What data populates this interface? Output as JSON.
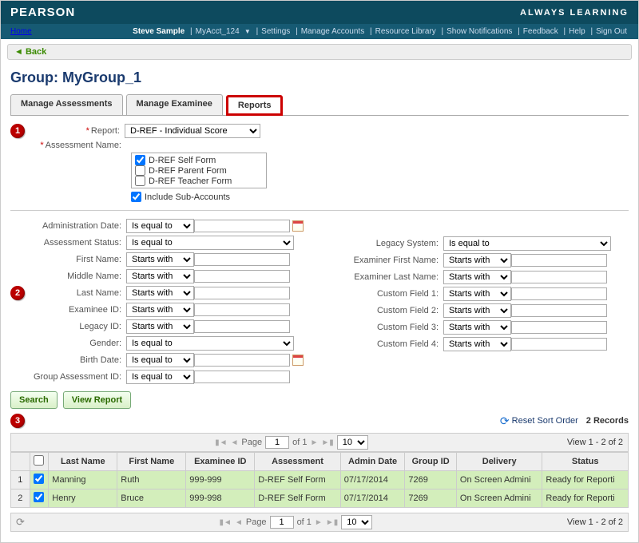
{
  "header": {
    "brand": "PEARSON",
    "tagline": "ALWAYS LEARNING"
  },
  "nav": {
    "home": "Home",
    "user": "Steve Sample",
    "links": [
      "MyAcct_124",
      "Settings",
      "Manage Accounts",
      "Resource Library",
      "Show Notifications",
      "Feedback",
      "Help",
      "Sign Out"
    ]
  },
  "back": "Back",
  "page_title": "Group: MyGroup_1",
  "tabs": {
    "manage_assessments": "Manage Assessments",
    "manage_examinee": "Manage Examinee",
    "reports": "Reports"
  },
  "callouts": {
    "one": "1",
    "two": "2",
    "three": "3"
  },
  "report_block": {
    "report_label": "Report:",
    "report_value": "D-REF - Individual Score",
    "assessment_label": "Assessment Name:",
    "forms": {
      "self": "D-REF Self Form",
      "parent": "D-REF Parent Form",
      "teacher": "D-REF Teacher Form"
    },
    "include_sub": "Include Sub-Accounts"
  },
  "ops": {
    "is_equal": "Is equal to",
    "starts_with": "Starts with"
  },
  "filters_left": {
    "admin_date": "Administration Date:",
    "assessment_status": "Assessment Status:",
    "first_name": "First Name:",
    "middle_name": "Middle Name:",
    "last_name": "Last Name:",
    "examinee_id": "Examinee ID:",
    "legacy_id": "Legacy ID:",
    "gender": "Gender:",
    "birth_date": "Birth Date:",
    "group_assessment_id": "Group Assessment ID:"
  },
  "filters_right": {
    "legacy_system": "Legacy System:",
    "examiner_first": "Examiner First Name:",
    "examiner_last": "Examiner Last Name:",
    "cf1": "Custom Field 1:",
    "cf2": "Custom Field 2:",
    "cf3": "Custom Field 3:",
    "cf4": "Custom Field 4:"
  },
  "buttons": {
    "search": "Search",
    "view_report": "View Report"
  },
  "grid": {
    "reset": "Reset Sort Order",
    "records": "2 Records",
    "page_label_pre": "Page",
    "page_value": "1",
    "page_label_of": "of 1",
    "page_size": "10",
    "view_range": "View 1 - 2 of 2",
    "headers": {
      "last": "Last Name",
      "first": "First Name",
      "exid": "Examinee ID",
      "assess": "Assessment",
      "admin": "Admin Date",
      "group": "Group ID",
      "delivery": "Delivery",
      "status": "Status"
    },
    "rows": [
      {
        "n": "1",
        "last": "Manning",
        "first": "Ruth",
        "exid": "999-999",
        "assess": "D-REF Self Form",
        "admin": "07/17/2014",
        "group": "7269",
        "delivery": "On Screen Admini",
        "status": "Ready for Reporti"
      },
      {
        "n": "2",
        "last": "Henry",
        "first": "Bruce",
        "exid": "999-998",
        "assess": "D-REF Self Form",
        "admin": "07/17/2014",
        "group": "7269",
        "delivery": "On Screen Admini",
        "status": "Ready for Reporti"
      }
    ]
  }
}
